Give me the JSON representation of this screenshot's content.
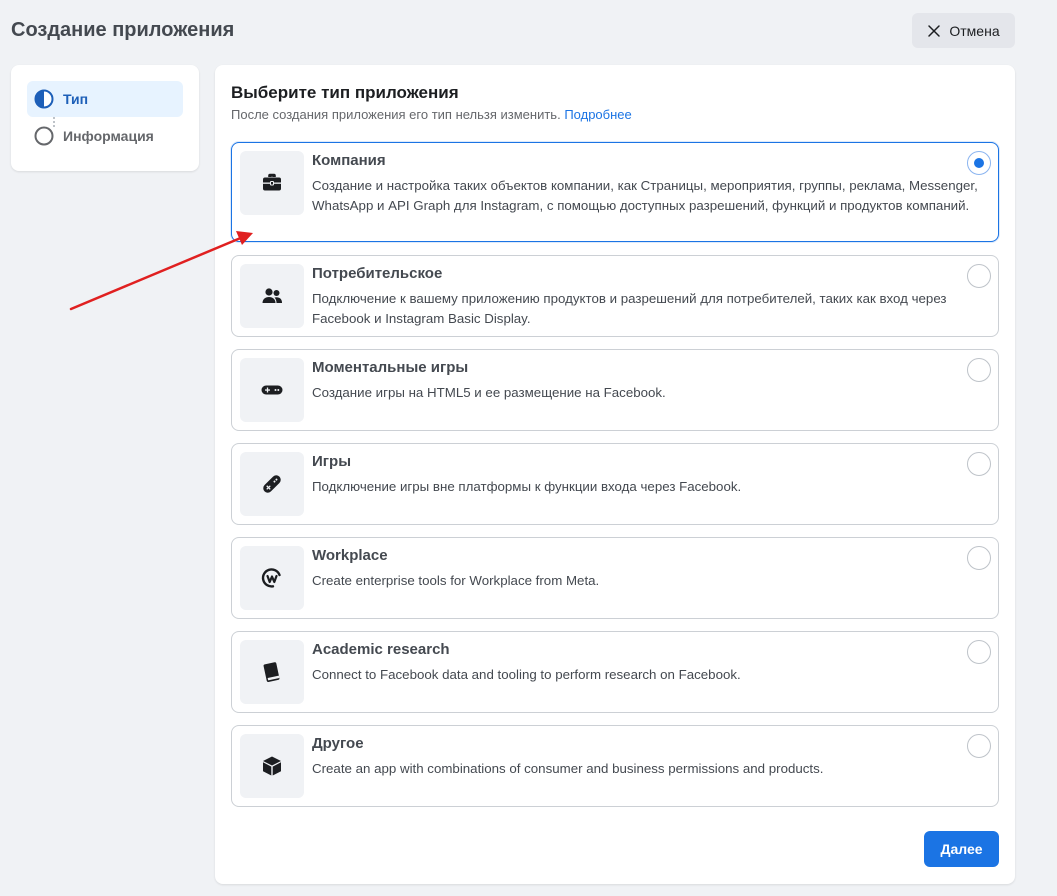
{
  "header": {
    "title": "Создание приложения",
    "cancel_label": "Отмена"
  },
  "steps": [
    {
      "label": "Тип",
      "state": "active"
    },
    {
      "label": "Информация",
      "state": "inactive"
    }
  ],
  "main": {
    "heading": "Выберите тип приложения",
    "subtitle": "После создания приложения его тип нельзя изменить.",
    "learn_more": "Подробнее",
    "next_label": "Далее"
  },
  "options": [
    {
      "title": "Компания",
      "description": "Создание и настройка таких объектов компании, как Страницы, мероприятия, группы, реклама, Messenger, WhatsApp и API Graph для Instagram, с помощью доступных разрешений, функций и продуктов компаний.",
      "icon": "briefcase-icon",
      "selected": true
    },
    {
      "title": "Потребительское",
      "description": "Подключение к вашему приложению продуктов и разрешений для потребителей, таких как вход через Facebook и Instagram Basic Display.",
      "icon": "people-icon",
      "selected": false
    },
    {
      "title": "Моментальные игры",
      "description": "Создание игры на HTML5 и ее размещение на Facebook.",
      "icon": "gamepad-icon",
      "selected": false
    },
    {
      "title": "Игры",
      "description": "Подключение игры вне платформы к функции входа через Facebook.",
      "icon": "controller-icon",
      "selected": false
    },
    {
      "title": "Workplace",
      "description": "Create enterprise tools for Workplace from Meta.",
      "icon": "workplace-icon",
      "selected": false
    },
    {
      "title": "Academic research",
      "description": "Connect to Facebook data and tooling to perform research on Facebook.",
      "icon": "book-icon",
      "selected": false
    },
    {
      "title": "Другое",
      "description": "Create an app with combinations of consumer and business permissions and products.",
      "icon": "cube-icon",
      "selected": false
    }
  ],
  "colors": {
    "accent": "#1b74e4",
    "annotation_arrow": "#e02020"
  }
}
